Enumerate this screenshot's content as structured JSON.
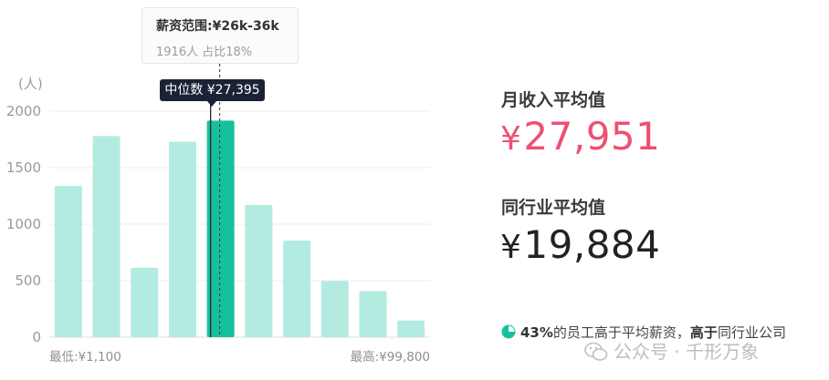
{
  "chart_data": {
    "type": "bar",
    "y_unit": "(人)",
    "categories": [
      "",
      "",
      "",
      "",
      "",
      "",
      "",
      "",
      "",
      ""
    ],
    "values": [
      1340,
      1780,
      615,
      1730,
      1916,
      1170,
      855,
      498,
      408,
      147
    ],
    "y_ticks": [
      0,
      500,
      1000,
      1500,
      2000
    ],
    "ylim": [
      0,
      2000
    ],
    "grid": true,
    "highlighted_index": 4,
    "bar_color": "#b4ebe0",
    "highlight_color": "#17c09d",
    "min_label": "最低:¥1,100",
    "max_label": "最高:¥99,800",
    "tooltip": {
      "title": "薪资范围:¥26k-36k",
      "subtitle": "1916人  占比18%"
    },
    "median_label": "中位数 ¥27,395"
  },
  "stats": {
    "monthly_avg_label": "月收入平均值",
    "monthly_avg_currency": "¥",
    "monthly_avg_value": "27,951",
    "monthly_avg_color": "#ef4f72",
    "industry_avg_label": "同行业平均值",
    "industry_avg_currency": "¥",
    "industry_avg_value": "19,884",
    "industry_avg_color": "#222222"
  },
  "footer": {
    "percent": "43%",
    "text_mid": "的员工高于平均薪资，",
    "bold": "高于",
    "text_end": "同行业公司",
    "icon": "pie-chart-icon",
    "icon_color": "#17c09d"
  },
  "watermark": {
    "text": "公众号 · 千形万象",
    "icon": "wechat-icon"
  }
}
